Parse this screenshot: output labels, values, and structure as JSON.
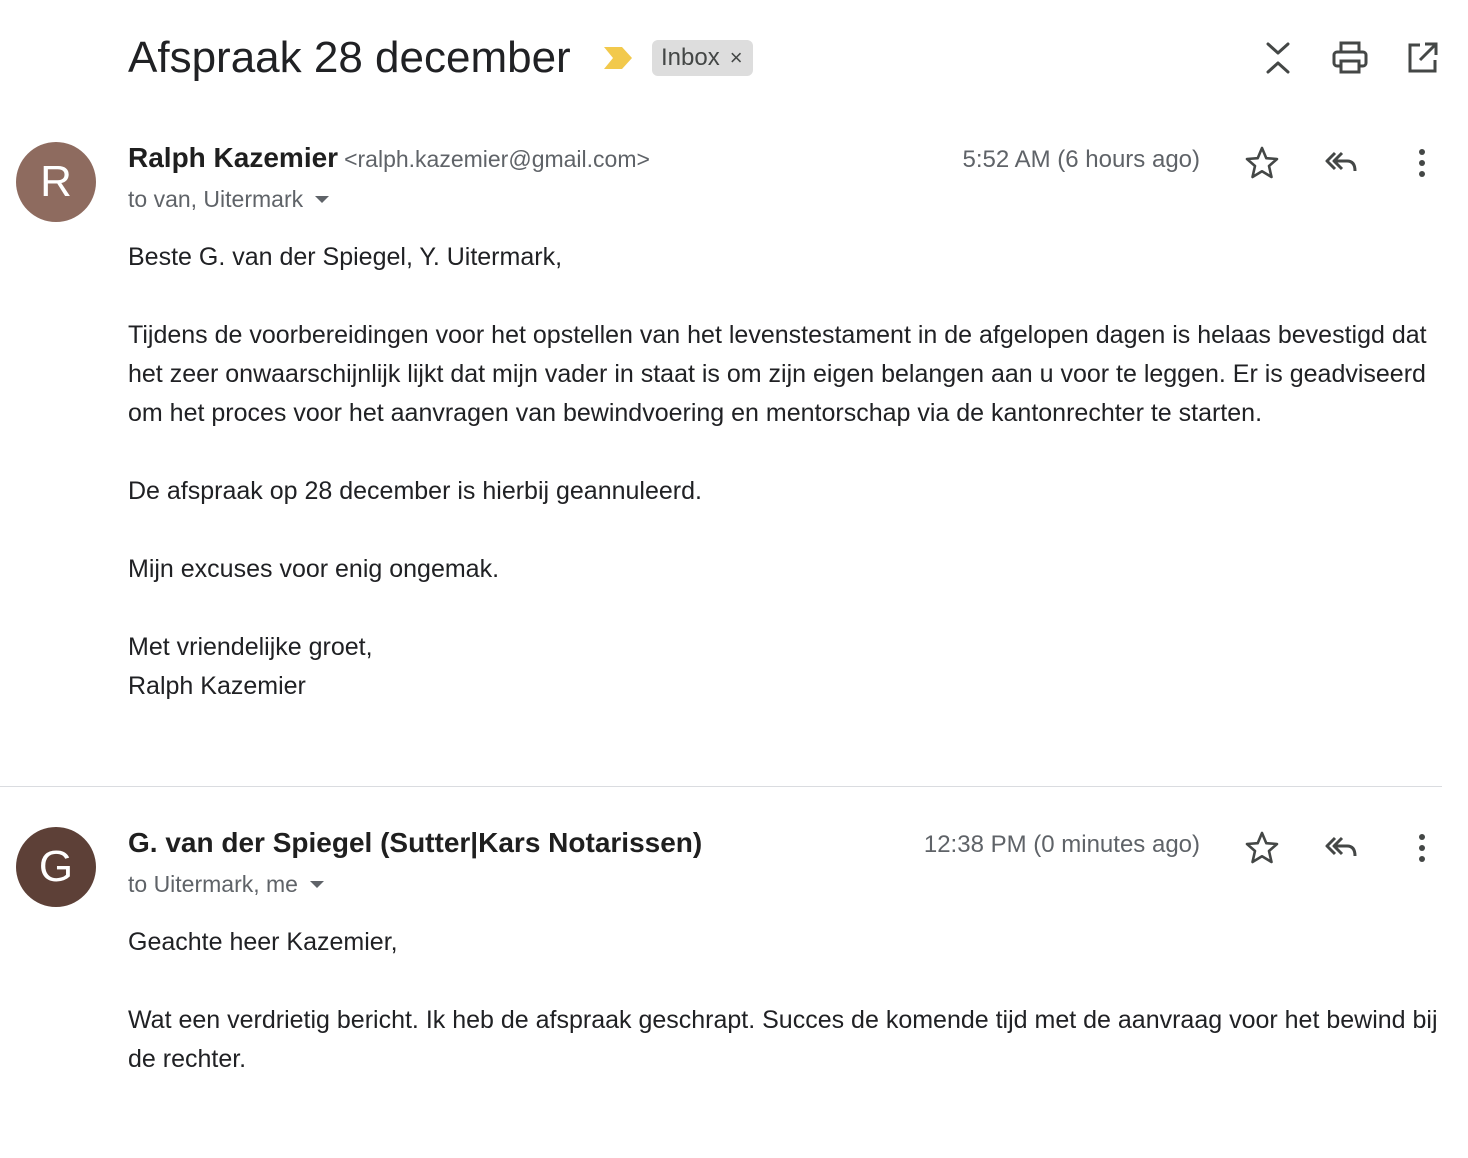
{
  "thread": {
    "subject": "Afspraak 28 december",
    "label": "Inbox",
    "label_remove": "×"
  },
  "toolbar": {
    "icons": [
      "collapse-all-icon",
      "print-icon",
      "open-in-new-window-icon"
    ]
  },
  "colors": {
    "importance_marker": "#f2c94c",
    "avatar_r": "#8e6b5f",
    "avatar_g": "#5d4037",
    "label_chip_bg": "#dddddd",
    "divider": "#dadce0"
  },
  "messages": [
    {
      "avatar_letter": "R",
      "sender_name": "Ralph Kazemier",
      "sender_email": "<ralph.kazemier@gmail.com>",
      "recipients": "to van, Uitermark",
      "time": "5:52 AM (6 hours ago)",
      "body": {
        "greeting": "Beste G. van der Spiegel, Y. Uitermark,",
        "para1": "Tijdens de voorbereidingen voor het opstellen van het levenstestament in de afgelopen dagen is helaas bevestigd dat het zeer onwaarschijnlijk lijkt dat mijn vader in staat is om zijn eigen belangen aan u voor te leggen. Er is geadviseerd om het proces voor het aanvragen van bewindvoering en mentorschap via de kantonrechter te starten.",
        "para2": "De afspraak op 28 december is hierbij geannuleerd.",
        "para3": "Mijn excuses voor enig ongemak.",
        "closing": "Met vriendelijke groet,",
        "signature": "Ralph Kazemier"
      }
    },
    {
      "avatar_letter": "G",
      "sender_name": "G. van der Spiegel (Sutter|Kars Notarissen)",
      "recipients": "to Uitermark, me",
      "time": "12:38 PM (0 minutes ago)",
      "body": {
        "greeting": "Geachte heer Kazemier,",
        "para1": "Wat een verdrietig bericht. Ik heb de afspraak geschrapt. Succes de komende tijd met de aanvraag voor het bewind bij de rechter."
      }
    }
  ]
}
